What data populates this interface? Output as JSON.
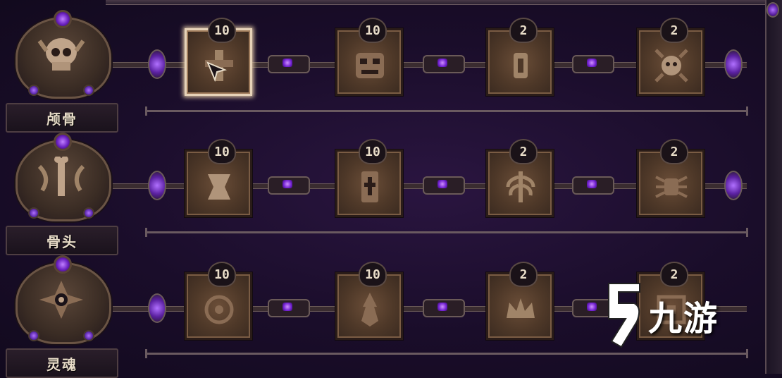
{
  "rows": [
    {
      "name": "颅骨",
      "emblem_icon": "skull-icon",
      "cards": [
        {
          "badge": "10",
          "icon": "bone-sigil-icon",
          "selected": true
        },
        {
          "badge": "10",
          "icon": "grinning-face-icon",
          "selected": false
        },
        {
          "badge": "2",
          "icon": "tombstone-icon",
          "selected": false
        },
        {
          "badge": "2",
          "icon": "skull-sun-icon",
          "selected": false
        }
      ]
    },
    {
      "name": "骨头",
      "emblem_icon": "crossed-bones-icon",
      "cards": [
        {
          "badge": "10",
          "icon": "bone-icon",
          "selected": false
        },
        {
          "badge": "10",
          "icon": "bone-cross-icon",
          "selected": false
        },
        {
          "badge": "2",
          "icon": "ribcage-icon",
          "selected": false
        },
        {
          "badge": "2",
          "icon": "spider-icon",
          "selected": false
        }
      ]
    },
    {
      "name": "灵魂",
      "emblem_icon": "soul-eye-icon",
      "cards": [
        {
          "badge": "10",
          "icon": "rune-circle-icon",
          "selected": false
        },
        {
          "badge": "10",
          "icon": "flame-spirit-icon",
          "selected": false
        },
        {
          "badge": "2",
          "icon": "crown-icon",
          "selected": false
        },
        {
          "badge": "2",
          "icon": "soul-pattern-icon",
          "selected": false
        }
      ]
    }
  ],
  "watermark": {
    "text": "九游",
    "icon": "nine-game-logo-icon"
  },
  "colors": {
    "gem": "#8a40ff",
    "card": "#5a4030",
    "background": "#1a0d2a",
    "frame": "#6a5a58"
  }
}
